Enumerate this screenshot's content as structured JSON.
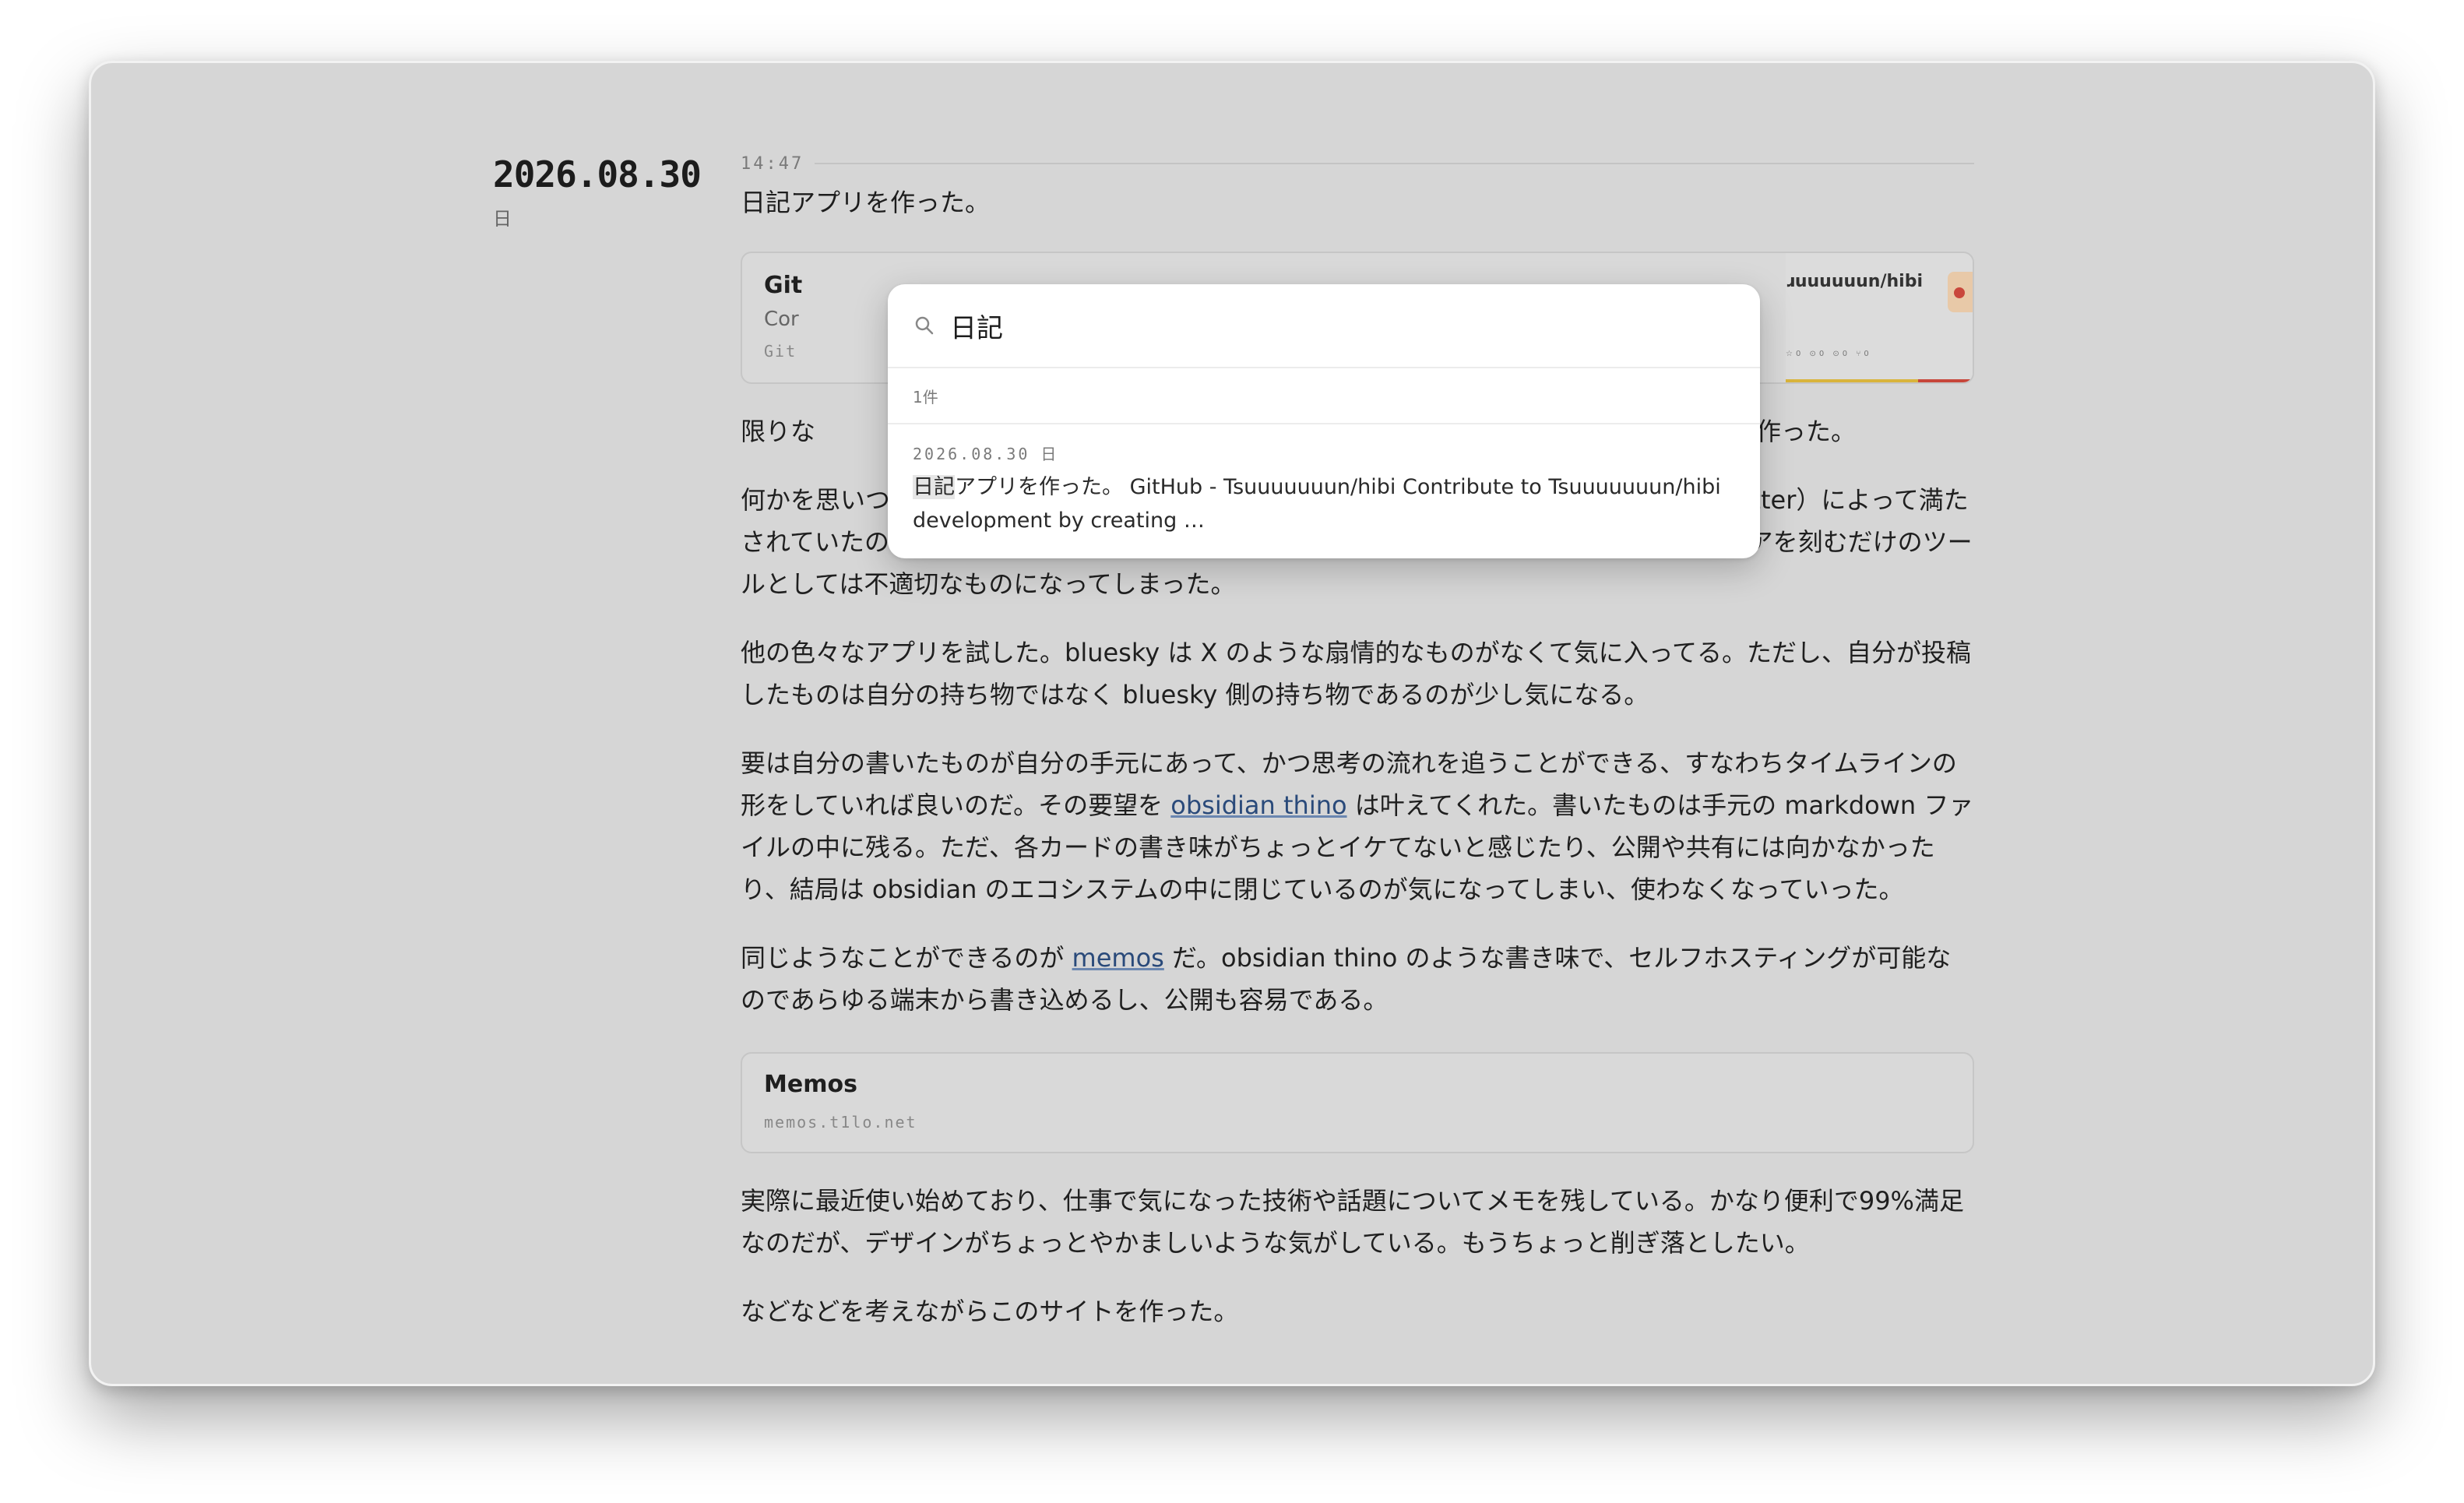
{
  "entry": {
    "date": "2026.08.30",
    "day_of_week": "日",
    "time": "14:47",
    "headline": "日記アプリを作った。"
  },
  "github_card": {
    "title": "Git",
    "description": "Cor",
    "url": "Git",
    "thumb_repo": "ɹuuuuuun/hibi",
    "thumb_stats": "☆0 ⊙0 ⊙0 ⑂0"
  },
  "paragraphs": {
    "p1_left": "限りな",
    "p1_right": "想の下で作った。",
    "p2": "何かを思いついたときに気軽にメモを取りたいという動機が常にあった。それはX（旧 Twitter）によって満たされていたのだが、今のXはユーザーを中毒にさせることに躍起になっており、単にアイデアを刻むだけのツールとしては不適切なものになってしまった。",
    "p3": "他の色々なアプリを試した。bluesky は X のような扇情的なものがなくて気に入ってる。ただし、自分が投稿したものは自分の持ち物ではなく bluesky 側の持ち物であるのが少し気になる。",
    "p4_a": "要は自分の書いたものが自分の手元にあって、かつ思考の流れを追うことができる、すなわちタイムラインの形をしていれば良いのだ。その要望を ",
    "p4_link": "obsidian thino",
    "p4_b": " は叶えてくれた。書いたものは手元の markdown ファイルの中に残る。ただ、各カードの書き味がちょっとイケてないと感じたり、公開や共有には向かなかったり、結局は obsidian のエコシステムの中に閉じているのが気になってしまい、使わなくなっていった。",
    "p5_a": "同じようなことができるのが ",
    "p5_link": "memos",
    "p5_b": " だ。obsidian thino のような書き味で、セルフホスティングが可能なのであらゆる端末から書き込めるし、公開も容易である。",
    "p6": "実際に最近使い始めており、仕事で気になった技術や話題についてメモを残している。かなり便利で99%満足なのだが、デザインがちょっとやかましいような気がしている。もうちょっと削ぎ落としたい。",
    "p7": "などなどを考えながらこのサイトを作った。"
  },
  "memos_card": {
    "title": "Memos",
    "url": "memos.t1lo.net"
  },
  "search": {
    "query": "日記",
    "count": "1件",
    "results": [
      {
        "date": "2026.08.30",
        "dow": "日",
        "highlight": "日記",
        "snippet_rest": "アプリを作った。 GitHub - Tsuuuuuuun/hibi Contribute to Tsuuuuuuun/hibi development by creating …"
      }
    ]
  },
  "colors": {
    "window_bg": "#d6d6d6",
    "link": "#2a4a7a",
    "popover_bg": "#ffffff"
  },
  "icons": {
    "search": "search-icon"
  }
}
